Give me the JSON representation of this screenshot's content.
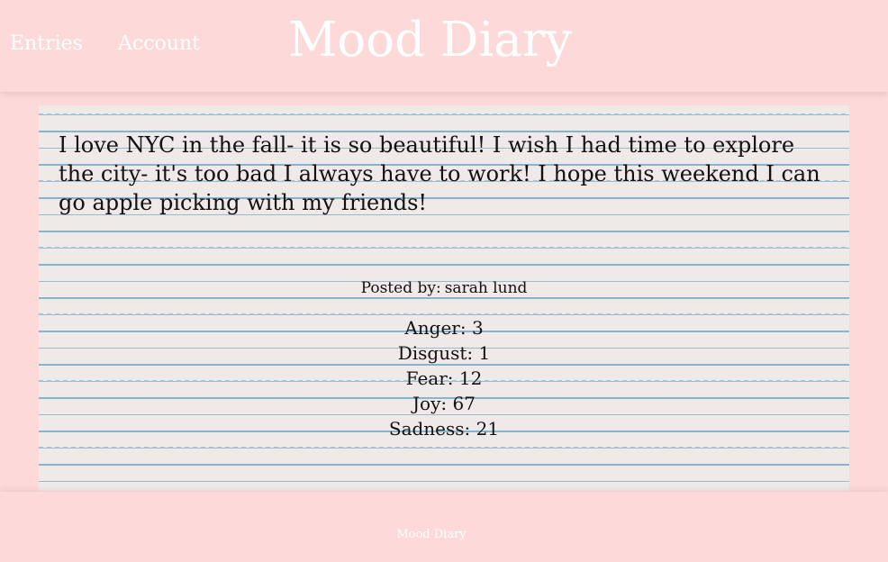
{
  "header": {
    "nav": {
      "entries_label": "Entries",
      "account_label": "Account"
    },
    "title": "Mood Diary"
  },
  "entry": {
    "text": "I love NYC in the fall- it is so beautiful! I wish I had time to explore the city- it's too bad I always have to work! I hope this weekend I can go apple picking with my friends!",
    "posted_by_label": "Posted by:",
    "author": "sarah lund",
    "moods": [
      {
        "label": "Anger",
        "value": 3
      },
      {
        "label": "Disgust",
        "value": 1
      },
      {
        "label": "Fear",
        "value": 12
      },
      {
        "label": "Joy",
        "value": 67
      },
      {
        "label": "Sadness",
        "value": 21
      }
    ]
  },
  "footer": {
    "text": "Mood Diary"
  },
  "colors": {
    "background": "#fdd9d9",
    "paper": "#efe9e8",
    "ruling": "#8bbad2",
    "text_light": "#ffffff",
    "text_dark": "#111111"
  }
}
